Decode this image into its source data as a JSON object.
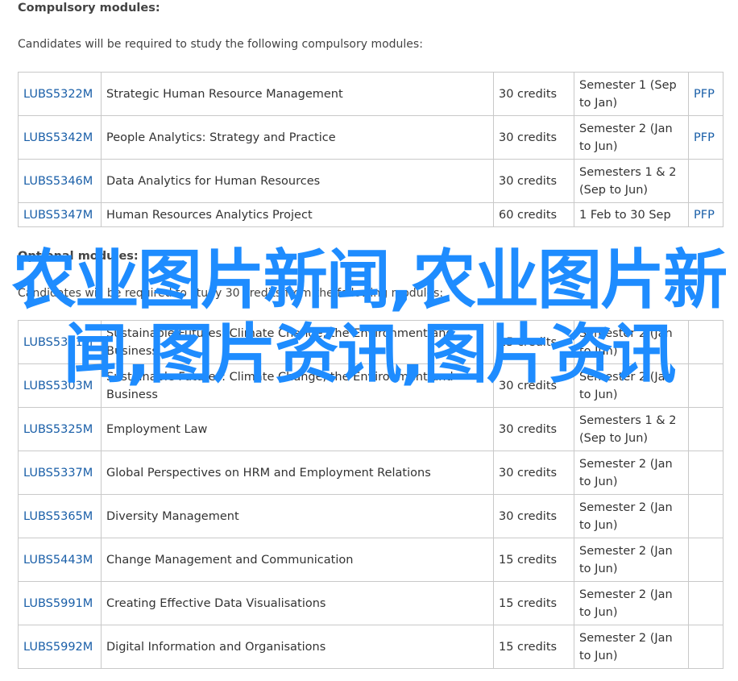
{
  "compulsory": {
    "heading": "Compulsory modules:",
    "intro": "Candidates will be required to study the following compulsory modules:",
    "rows": [
      {
        "code": "LUBS5322M",
        "title": "Strategic Human Resource Management",
        "credits": "30 credits",
        "semester": "Semester 1 (Sep to Jan)",
        "spec": "PFP"
      },
      {
        "code": "LUBS5342M",
        "title": "People Analytics: Strategy and Practice",
        "credits": "30 credits",
        "semester": "Semester 2 (Jan to Jun)",
        "spec": "PFP"
      },
      {
        "code": "LUBS5346M",
        "title": "Data Analytics for Human Resources",
        "credits": "30 credits",
        "semester": "Semesters 1 & 2 (Sep to Jun)",
        "spec": ""
      },
      {
        "code": "LUBS5347M",
        "title": "Human Resources Analytics Project",
        "credits": "60 credits",
        "semester": "1 Feb to 30 Sep",
        "spec": "PFP"
      }
    ]
  },
  "optional": {
    "heading": "Optional modules:",
    "intro": "Candidates will be required to study 30 credits from the following modules:",
    "rows": [
      {
        "code": "LUBS5301M",
        "title": "Sustainable Futures: Climate Change, the Environment and Business",
        "credits": "15 credits",
        "semester": "Semester 2 (Jan to Jun)",
        "spec": ""
      },
      {
        "code": "LUBS5303M",
        "title": "Sustainable Futures: Climate Change, the Environment and Business",
        "credits": "30 credits",
        "semester": "Semester 2 (Jan to Jun)",
        "spec": ""
      },
      {
        "code": "LUBS5325M",
        "title": "Employment Law",
        "credits": "30 credits",
        "semester": "Semesters 1 & 2 (Sep to Jun)",
        "spec": ""
      },
      {
        "code": "LUBS5337M",
        "title": "Global Perspectives on HRM and Employment Relations",
        "credits": "30 credits",
        "semester": "Semester 2 (Jan to Jun)",
        "spec": ""
      },
      {
        "code": "LUBS5365M",
        "title": "Diversity Management",
        "credits": "30 credits",
        "semester": "Semester 2 (Jan to Jun)",
        "spec": ""
      },
      {
        "code": "LUBS5443M",
        "title": "Change Management and Communication",
        "credits": "15 credits",
        "semester": "Semester 2 (Jan to Jun)",
        "spec": ""
      },
      {
        "code": "LUBS5991M",
        "title": "Creating Effective Data Visualisations",
        "credits": "15 credits",
        "semester": "Semester 2 (Jan to Jun)",
        "spec": ""
      },
      {
        "code": "LUBS5992M",
        "title": "Digital Information and Organisations",
        "credits": "15 credits",
        "semester": "Semester 2 (Jan to Jun)",
        "spec": ""
      }
    ]
  },
  "watermark": {
    "text": "农业图片新闻,农业图片新闻,图片资讯,图片资讯"
  },
  "colors": {
    "link": "#1a5fa8",
    "border": "#c9c9c9",
    "watermark": "#1e8cff",
    "text": "#333333"
  }
}
